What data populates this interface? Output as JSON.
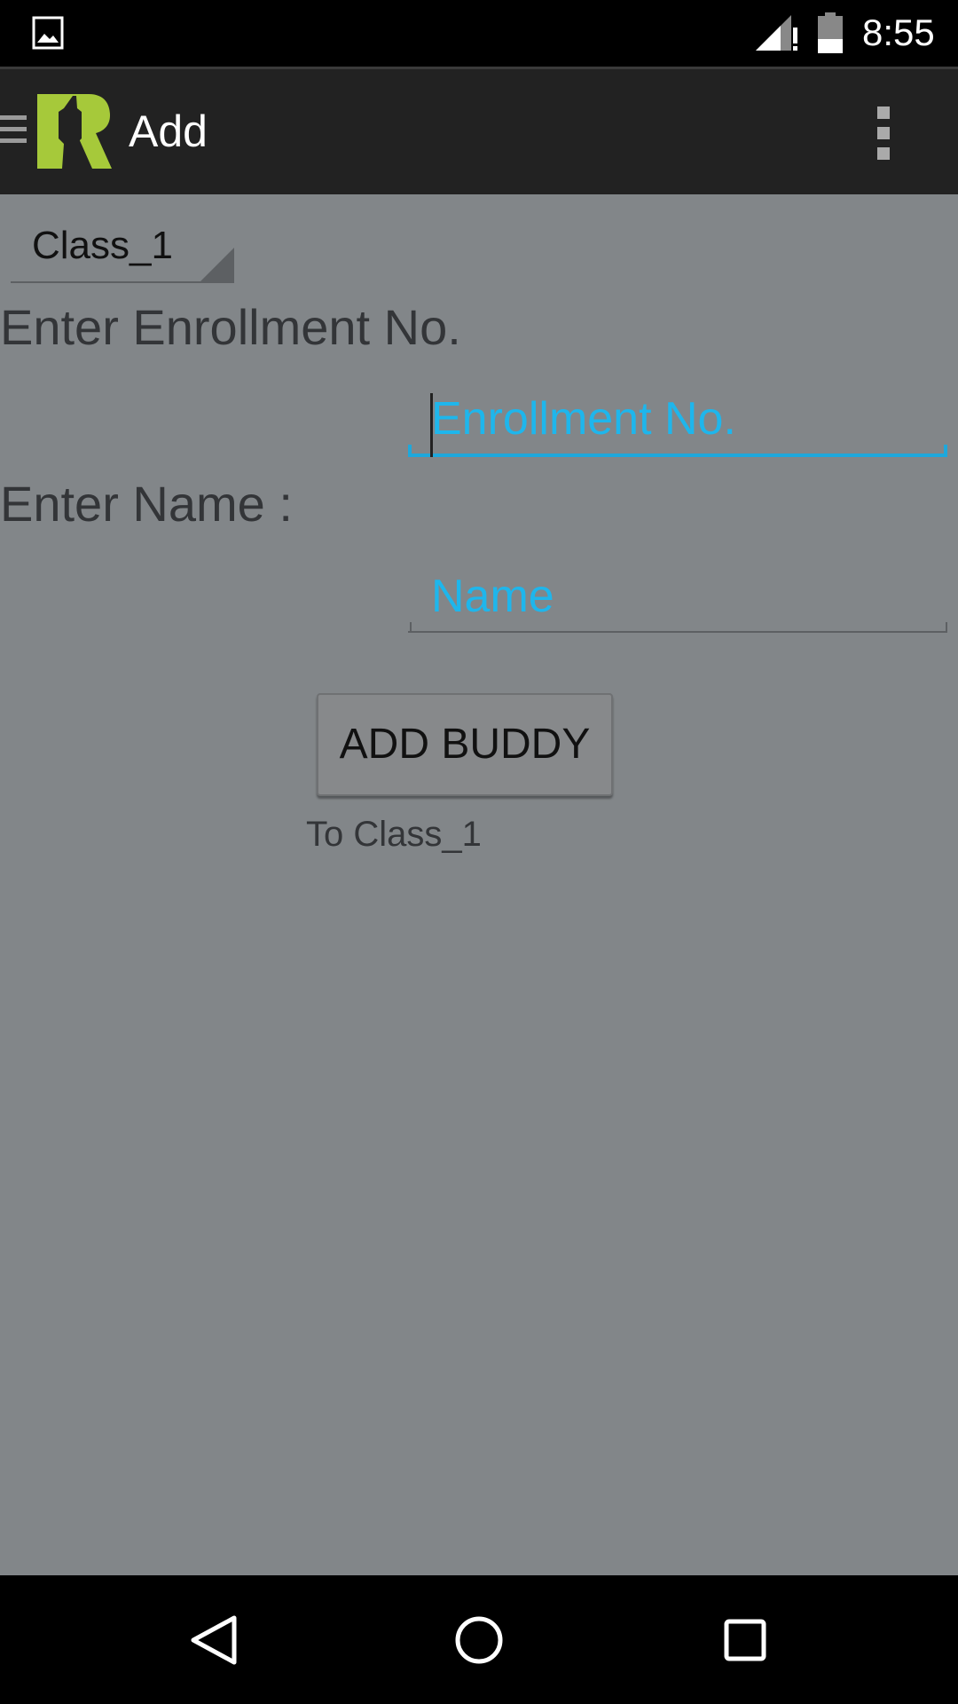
{
  "status_bar": {
    "time": "8:55",
    "icons": [
      "gallery-icon",
      "signal-icon",
      "battery-icon"
    ]
  },
  "app_bar": {
    "title": "Add",
    "icons": [
      "drawer-icon",
      "app-logo",
      "overflow-menu-icon"
    ],
    "logo_colors": [
      "#a6c93a",
      "#222222"
    ]
  },
  "form": {
    "class_spinner_value": "Class_1",
    "enrollment_label": "Enter Enrollment No.",
    "enrollment_placeholder": "Enrollment No.",
    "name_label": "Enter Name :",
    "name_placeholder": "Name",
    "add_button_label": "ADD BUDDY",
    "target_hint": "To Class_1"
  },
  "nav_bar": {
    "icons": [
      "back-icon",
      "home-icon",
      "recents-icon"
    ]
  },
  "colors": {
    "background": "#828689",
    "accent": "#1eb6ec",
    "app_bar": "#222222"
  }
}
